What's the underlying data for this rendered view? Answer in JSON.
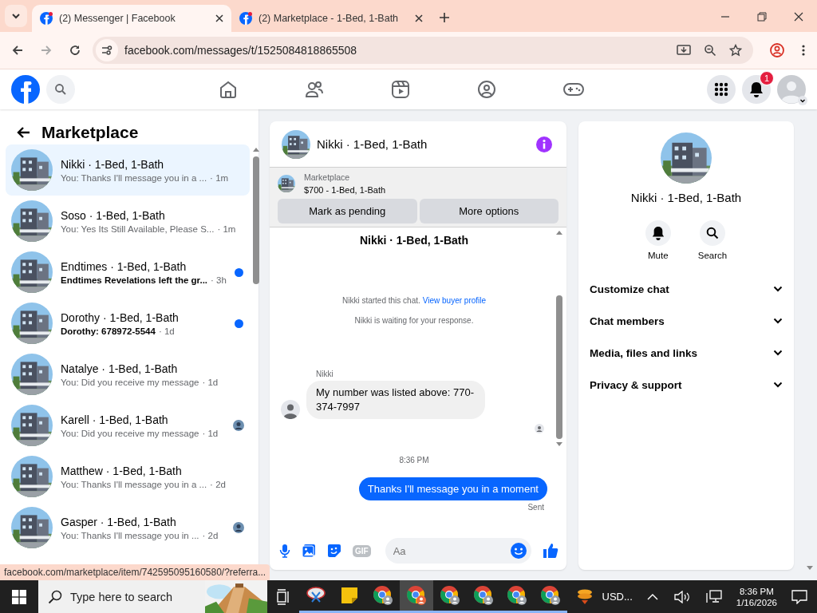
{
  "browser": {
    "tabs": [
      {
        "title": "(2) Messenger | Facebook",
        "selected": true
      },
      {
        "title": "(2) Marketplace - 1-Bed, 1-Bath",
        "selected": false
      }
    ],
    "url": "facebook.com/messages/t/1525084818865508"
  },
  "header": {
    "notification_count": "1"
  },
  "sidebar": {
    "title": "Marketplace",
    "conversations": [
      {
        "name": "Nikki · 1-Bed, 1-Bath",
        "preview": "You: Thanks I'll message you in a ...",
        "time": "· 1m",
        "unread": false,
        "seen": false,
        "selected": true
      },
      {
        "name": "Soso · 1-Bed, 1-Bath",
        "preview": "You: Yes Its Still Available, Please S...",
        "time": "· 1m",
        "unread": false,
        "seen": false,
        "selected": false
      },
      {
        "name": "Endtimes · 1-Bed, 1-Bath",
        "preview": "Endtimes Revelations left the gr...",
        "time": "· 3h",
        "unread": true,
        "seen": false,
        "selected": false
      },
      {
        "name": "Dorothy · 1-Bed, 1-Bath",
        "preview": "Dorothy: 678972-5544",
        "time": "· 1d",
        "unread": true,
        "seen": false,
        "selected": false
      },
      {
        "name": "Natalye · 1-Bed, 1-Bath",
        "preview": "You: Did you receive my message",
        "time": "· 1d",
        "unread": false,
        "seen": false,
        "selected": false
      },
      {
        "name": "Karell · 1-Bed, 1-Bath",
        "preview": "You: Did you receive my message",
        "time": "· 1d",
        "unread": false,
        "seen": true,
        "selected": false
      },
      {
        "name": "Matthew · 1-Bed, 1-Bath",
        "preview": "You: Thanks I'll message you in a ...",
        "time": "· 2d",
        "unread": false,
        "seen": false,
        "selected": false
      },
      {
        "name": "Gasper · 1-Bed, 1-Bath",
        "preview": "You: Thanks I'll message you in ...",
        "time": "· 2d",
        "unread": false,
        "seen": true,
        "selected": false
      }
    ]
  },
  "chat": {
    "title": "Nikki · 1-Bed, 1-Bath",
    "listing": {
      "source": "Marketplace",
      "title": "$700 - 1-Bed, 1-Bath"
    },
    "actions": [
      "Mark as pending",
      "More options"
    ],
    "intro_name": "Nikki · 1-Bed, 1-Bath",
    "started": "Nikki started this chat.",
    "profile_link": "View buyer profile",
    "waiting": "Nikki is waiting for your response.",
    "messages": [
      {
        "kind": "incoming",
        "sender": "Nikki",
        "text": "My number was listed above: 770-374-7997"
      },
      {
        "kind": "time",
        "text": "8:36 PM"
      },
      {
        "kind": "outgoing",
        "text": "Thanks I'll message you in a moment",
        "status": "Sent"
      }
    ],
    "composer": {
      "placeholder": "Aa",
      "gif_label": "GIF"
    }
  },
  "details": {
    "name": "Nikki · 1-Bed, 1-Bath",
    "actions": [
      {
        "label": "Mute"
      },
      {
        "label": "Search"
      }
    ],
    "sections": [
      "Customize chat",
      "Chat members",
      "Media, files and links",
      "Privacy & support"
    ]
  },
  "link_preview": "facebook.com/marketplace/item/742595095160580/?referra...",
  "taskbar": {
    "search_placeholder": "Type here to search",
    "apps": [
      {
        "kind": "snip",
        "selected": false
      },
      {
        "kind": "notes",
        "selected": false
      },
      {
        "kind": "browser",
        "selected": false
      },
      {
        "kind": "browser",
        "selected": true
      },
      {
        "kind": "browser",
        "selected": false
      },
      {
        "kind": "browser",
        "selected": false
      },
      {
        "kind": "browser",
        "selected": false
      },
      {
        "kind": "browser",
        "selected": false
      }
    ],
    "tray_app": "USD...",
    "time": "8:36 PM",
    "date": "1/16/2026"
  }
}
